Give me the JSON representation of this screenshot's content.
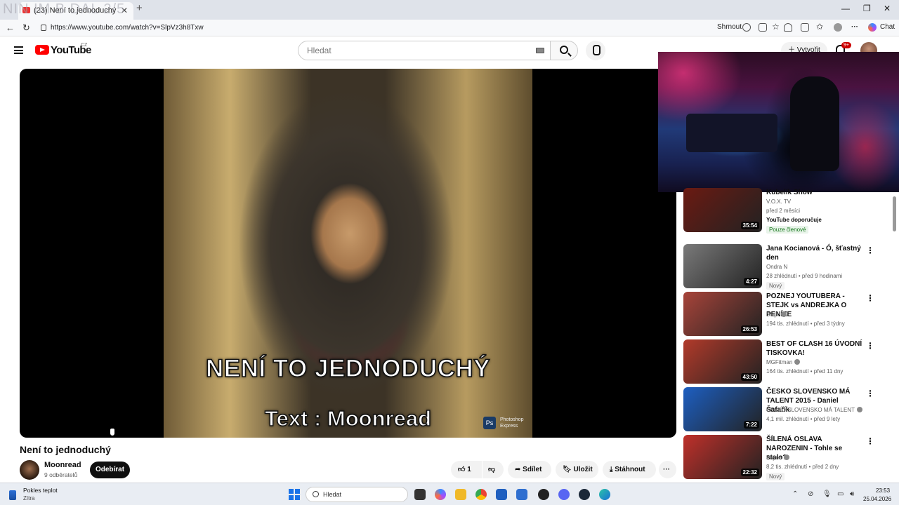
{
  "browser": {
    "tab_title": "(23) Není to jednoduchý",
    "watermark": "NIN IM B DAL 2/5",
    "url": "https://www.youtube.com/watch?v=SlpVz3h8Txw",
    "summary_label": "Shrnout",
    "chat_label": "Chat"
  },
  "youtube": {
    "logo_text": "YouTube",
    "country": "CZ",
    "search_placeholder": "Hledat",
    "create_label": "Vytvořit",
    "notification_count": "9+"
  },
  "video": {
    "overlay_title": "NENÍ TO JEDNODUCHÝ",
    "overlay_text": "Text : Moonread",
    "ps_badge": "Ps",
    "ps_label_1": "Photoshop",
    "ps_label_2": "Express",
    "title": "Není to jednoduchý",
    "channel": "Moonread",
    "subscribers": "9 odběratelů",
    "subscribe_label": "Odebírat",
    "likes": "1",
    "share_label": "Sdílet",
    "save_label": "Uložit",
    "download_label": "Stáhnout"
  },
  "recommendations": [
    {
      "title": "Kubelík Show",
      "channel": "V.O.X. TV",
      "meta": "před 2 měsíci",
      "extra": "YouTube doporučuje",
      "badge": "Pouze členové",
      "duration": "35:54",
      "thumb": "#6b1a12"
    },
    {
      "title": "Jana Kocianová - Ó, šťastný den",
      "channel": "Ondra N",
      "meta": "28 zhlédnutí • před 9 hodinami",
      "badge": "Nový",
      "duration": "4:27",
      "thumb": "#7a7a7a"
    },
    {
      "title": "POZNEJ YOUTUBERA - STEJK vs ANDREJKA O PENÍZE",
      "channel": "Stejk",
      "meta": "194 tis. zhlédnutí • před 3 týdny",
      "duration": "26:53",
      "thumb": "#a8443a"
    },
    {
      "title": "BEST OF CLASH 16 ÚVODNÍ TISKOVKA!",
      "channel": "MGFitman",
      "meta": "164 tis. zhlédnutí • před 11 dny",
      "duration": "43:50",
      "thumb": "#b23a2a"
    },
    {
      "title": "ČESKO SLOVENSKO MÁ TALENT 2015 - Daniel Šafařík",
      "channel": "ČESKO SLOVENSKO MÁ TALENT",
      "meta": "4,1 mil. zhlédnutí • před 9 lety",
      "duration": "7:22",
      "thumb": "#1d5fc2"
    },
    {
      "title": "ŠÍLENÁ OSLAVA NAROZENIN - Tohle se stalo?",
      "channel": "Fayne",
      "meta": "8,2 tis. zhlédnutí • před 2 dny",
      "badge": "Nový",
      "duration": "22:32",
      "thumb": "#c0302a"
    }
  ],
  "taskbar": {
    "weather_line1": "Pokles teplot",
    "weather_line2": "Zítra",
    "search_label": "Hledat",
    "time": "23:53",
    "date": "25.04.2026"
  }
}
